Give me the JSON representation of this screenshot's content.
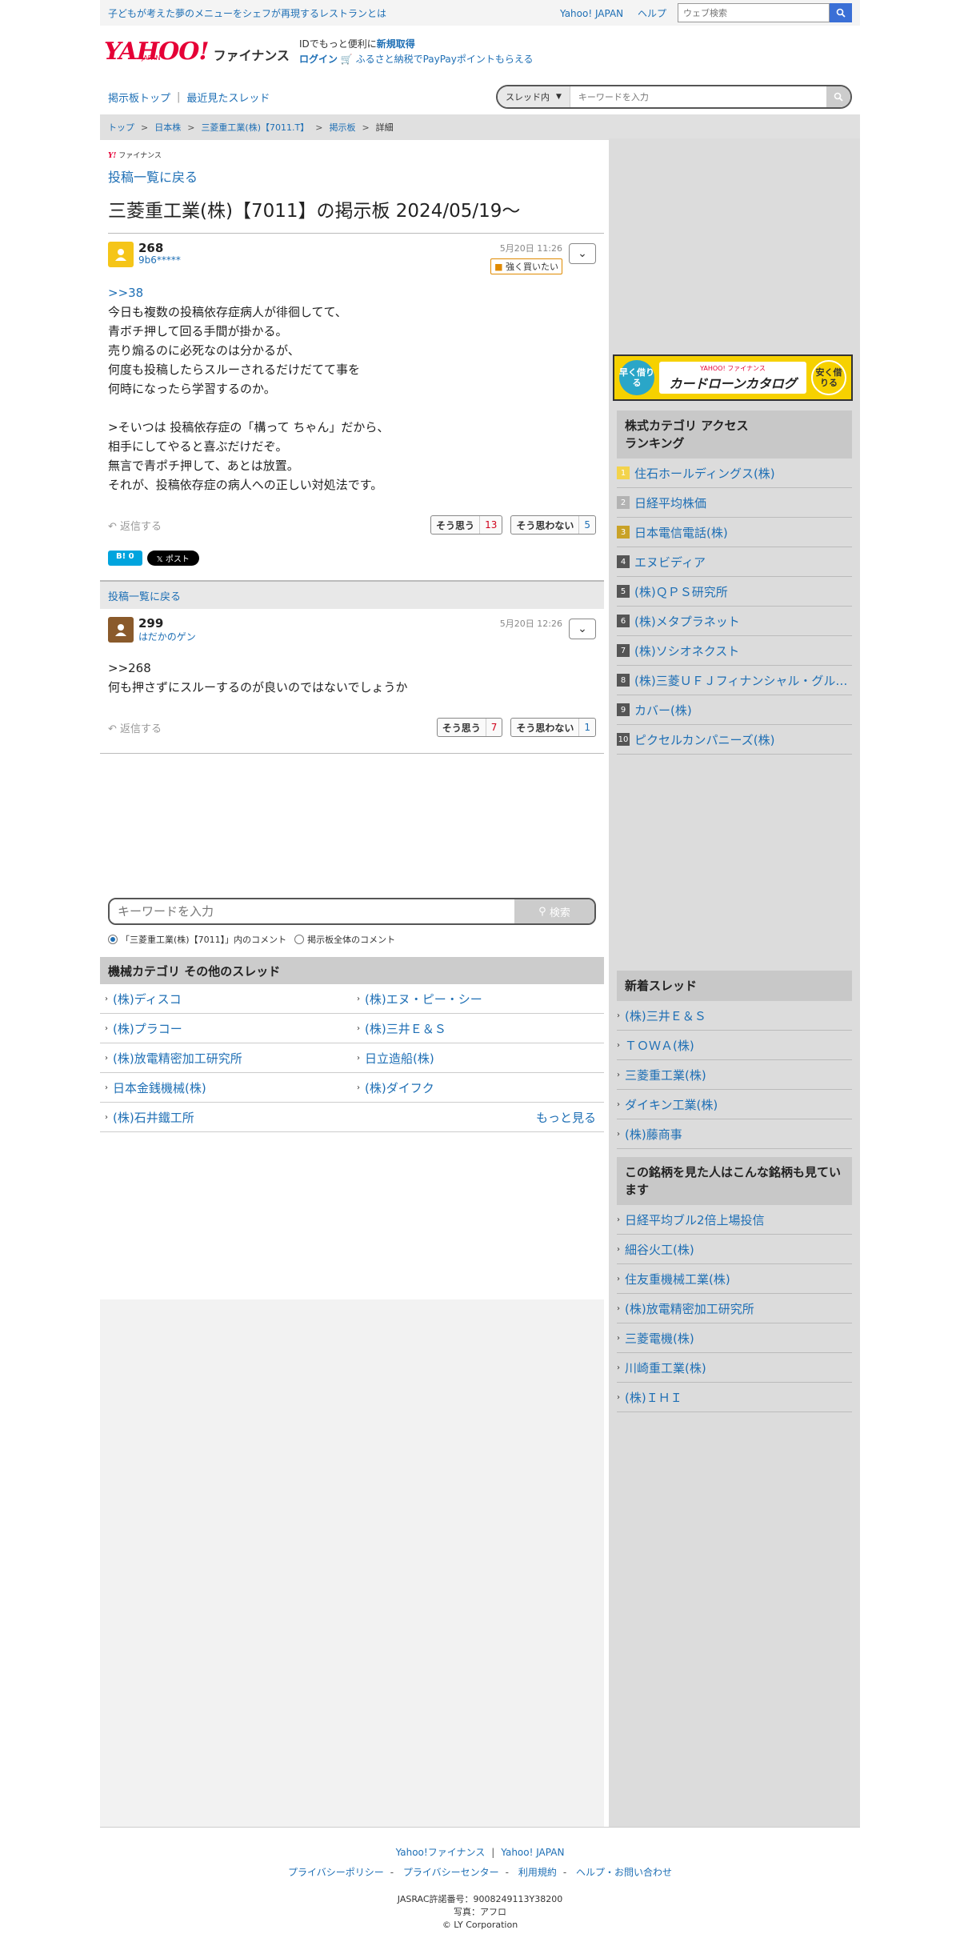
{
  "topbar": {
    "promo": "子どもが考えた夢のメニューをシェフが再現するレストランとは",
    "yahoo_japan": "Yahoo! JAPAN",
    "help": "ヘルプ",
    "search_placeholder": "ウェブ検索"
  },
  "header": {
    "logo_text": "YAHOO!",
    "logo_sub": "JAPAN",
    "logo_fin": "ファイナンス",
    "id_text": "IDでもっと便利に",
    "signup": "新規取得",
    "login": "ログイン",
    "furusato": "ふるさと納税でPayPayポイントもらえる"
  },
  "nav": {
    "board_top": "掲示板トップ",
    "recent": "最近見たスレッド",
    "scope": "スレッド内",
    "search_placeholder": "キーワードを入力"
  },
  "breadcrumb": [
    "トップ",
    "日本株",
    "三菱重工業(株)【7011.T】",
    "掲示板",
    "詳細"
  ],
  "main": {
    "mini_logo_y": "Y!",
    "mini_logo_text": "ファイナンス",
    "back_link": "投稿一覧に戻る",
    "title": "三菱重工業(株)【7011】の掲示板 2024/05/19〜"
  },
  "posts": [
    {
      "num": "268",
      "user": "9b6*****",
      "date": "5月20日 11:26",
      "badge": "強く買いたい",
      "anchor": ">>38",
      "body": "今日も複数の投稿依存症病人が徘徊してて、\n青ボチ押して回る手間が掛かる。\n売り煽るのに必死なのは分かるが、\n何度も投稿したらスルーされるだけだてて事を\n何時になったら学習するのか。\n\n>そいつは 投稿依存症の「構って ちゃん」だから、\n相手にしてやると喜ぶだけだぞ。\n無言で青ポチ押して、あとは放置。\nそれが、投稿依存症の病人への正しい対処法です。",
      "reply": "返信する",
      "agree_label": "そう思う",
      "agree": "13",
      "disagree_label": "そう思わない",
      "disagree": "5",
      "hatena": "B! 0",
      "x_post": "𝕏 ポスト"
    },
    {
      "num": "299",
      "user": "はだかのゲン",
      "date": "5月20日 12:26",
      "body": ">>268\n何も押さずにスルーするのが良いのではないでしょうか",
      "reply": "返信する",
      "agree_label": "そう思う",
      "agree": "7",
      "disagree_label": "そう思わない",
      "disagree": "1"
    }
  ],
  "back_bar": "投稿一覧に戻る",
  "comment_search": {
    "placeholder": "キーワードを入力",
    "button": "検索",
    "radio1": "「三菱重工業(株)【7011】」内のコメント",
    "radio2": "掲示板全体のコメント"
  },
  "category": {
    "heading": "機械カテゴリ その他のスレッド",
    "items": [
      "(株)ディスコ",
      "(株)エヌ・ピー・シー",
      "(株)プラコー",
      "(株)三井Ｅ＆Ｓ",
      "(株)放電精密加工研究所",
      "日立造船(株)",
      "日本金銭機械(株)",
      "(株)ダイフク",
      "(株)石井鐵工所"
    ],
    "more": "もっと見る"
  },
  "sidebar": {
    "ad": {
      "left": "早く借りる",
      "brand": "YAHOO! ファイナンス",
      "title": "カードローンカタログ",
      "right": "安く借りる"
    },
    "ranking_heading": "株式カテゴリ アクセスランキング",
    "ranking": [
      {
        "no": "1",
        "label": "住石ホールディングス(株)"
      },
      {
        "no": "2",
        "label": "日経平均株価"
      },
      {
        "no": "3",
        "label": "日本電信電話(株)"
      },
      {
        "no": "4",
        "label": "エヌビディア"
      },
      {
        "no": "5",
        "label": "(株)ＱＰＳ研究所"
      },
      {
        "no": "6",
        "label": "(株)メタプラネット"
      },
      {
        "no": "7",
        "label": "(株)ソシオネクスト"
      },
      {
        "no": "8",
        "label": "(株)三菱ＵＦＪフィナンシャル・グループ"
      },
      {
        "no": "9",
        "label": "カバー(株)"
      },
      {
        "no": "10",
        "label": "ピクセルカンパニーズ(株)"
      }
    ],
    "new_heading": "新着スレッド",
    "new_threads": [
      "(株)三井Ｅ＆Ｓ",
      "ＴＯＷＡ(株)",
      "三菱重工業(株)",
      "ダイキン工業(株)",
      "(株)藤商事"
    ],
    "also_heading": "この銘柄を見た人はこんな銘柄も見ています",
    "also": [
      "日経平均ブル2倍上場投信",
      "細谷火工(株)",
      "住友重機械工業(株)",
      "(株)放電精密加工研究所",
      "三菱電機(株)",
      "川崎重工業(株)",
      "(株)ＩＨＩ"
    ]
  },
  "footer": {
    "yfin": "Yahoo!ファイナンス",
    "yjp": "Yahoo! JAPAN",
    "privacy_policy": "プライバシーポリシー",
    "privacy_center": "プライバシーセンター",
    "terms": "利用規約",
    "help": "ヘルプ・お問い合わせ",
    "jasrac": "JASRAC許諾番号：9008249113Y38200",
    "photo": "写真：アフロ",
    "copyright": "© LY Corporation"
  }
}
